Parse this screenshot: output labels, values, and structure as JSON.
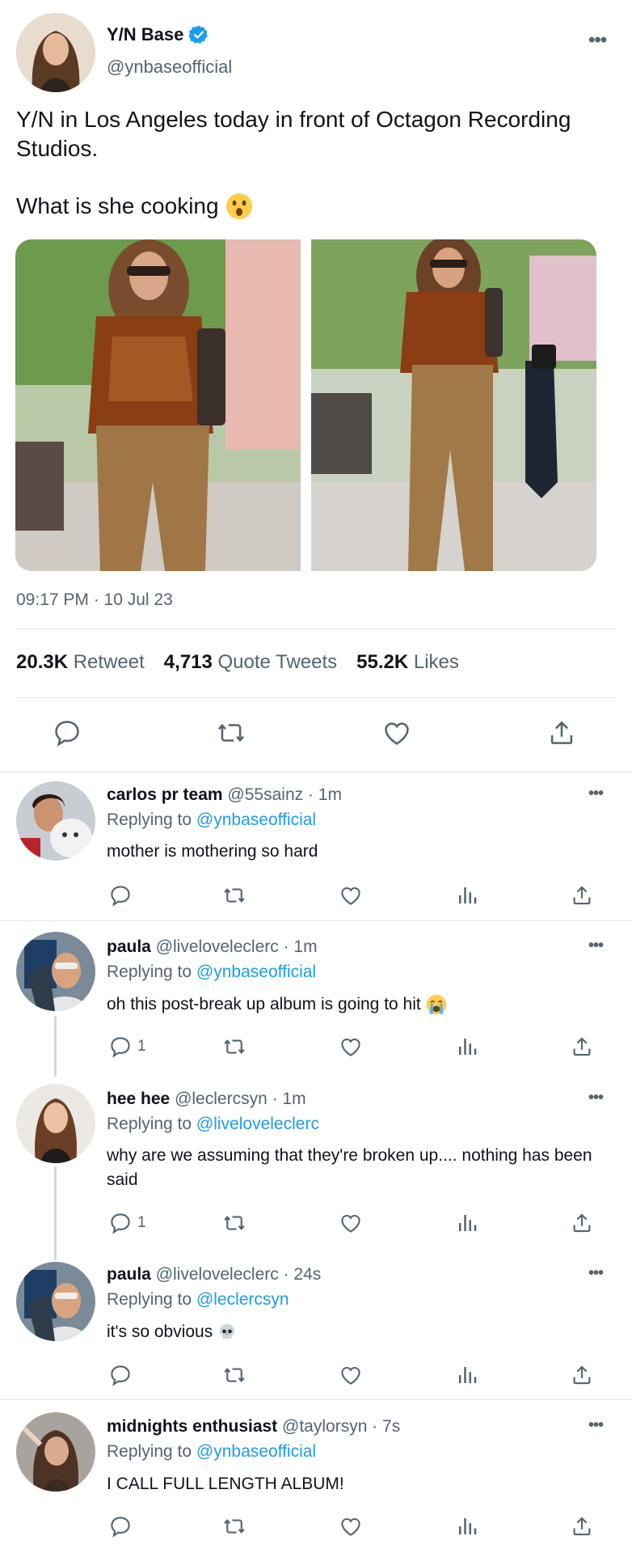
{
  "tweet": {
    "display_name": "Y/N Base",
    "handle": "@ynbaseofficial",
    "text_line1": "Y/N in Los Angeles today in front of Octagon Recording Studios.",
    "text_line2": "What is she cooking",
    "timestamp": "09:17 PM · 10 Jul 23",
    "stats": {
      "retweets_value": "20.3K",
      "retweets_label": "Retweet",
      "quotes_value": "4,713",
      "quotes_label": "Quote Tweets",
      "likes_value": "55.2K",
      "likes_label": "Likes"
    },
    "more_label": "•••"
  },
  "replies": [
    {
      "name": "carlos pr team",
      "handle": "@55sainz",
      "time": "· 1m",
      "replying_prefix": "Replying to",
      "replying_to": "@ynbaseofficial",
      "text": "mother is mothering so hard",
      "reply_count": ""
    },
    {
      "name": "paula",
      "handle": "@liveloveleclerc",
      "time": "· 1m",
      "replying_prefix": "Replying to",
      "replying_to": "@ynbaseofficial",
      "text": "oh this post-break up album is going to hit",
      "reply_count": "1"
    },
    {
      "name": "hee hee",
      "handle": "@leclercsyn",
      "time": "· 1m",
      "replying_prefix": "Replying to",
      "replying_to": "@liveloveleclerc",
      "text": "why are we assuming that they're broken up.... nothing has been said",
      "reply_count": "1"
    },
    {
      "name": "paula",
      "handle": "@liveloveleclerc",
      "time": "· 24s",
      "replying_prefix": "Replying to",
      "replying_to": "@leclercsyn",
      "text": "it's so obvious",
      "reply_count": ""
    },
    {
      "name": "midnights enthusiast",
      "handle": "@taylorsyn",
      "time": "· 7s",
      "replying_prefix": "Replying to",
      "replying_to": "@ynbaseofficial",
      "text": "I CALL FULL LENGTH ALBUM!",
      "reply_count": ""
    }
  ],
  "icons": [
    "reply-icon",
    "retweet-icon",
    "like-icon",
    "analytics-icon",
    "share-icon",
    "verified-badge-icon",
    "more-icon"
  ],
  "colors": {
    "accent": "#1d9bf0",
    "secondary_text": "#536471",
    "divider": "#e1e8ed"
  }
}
